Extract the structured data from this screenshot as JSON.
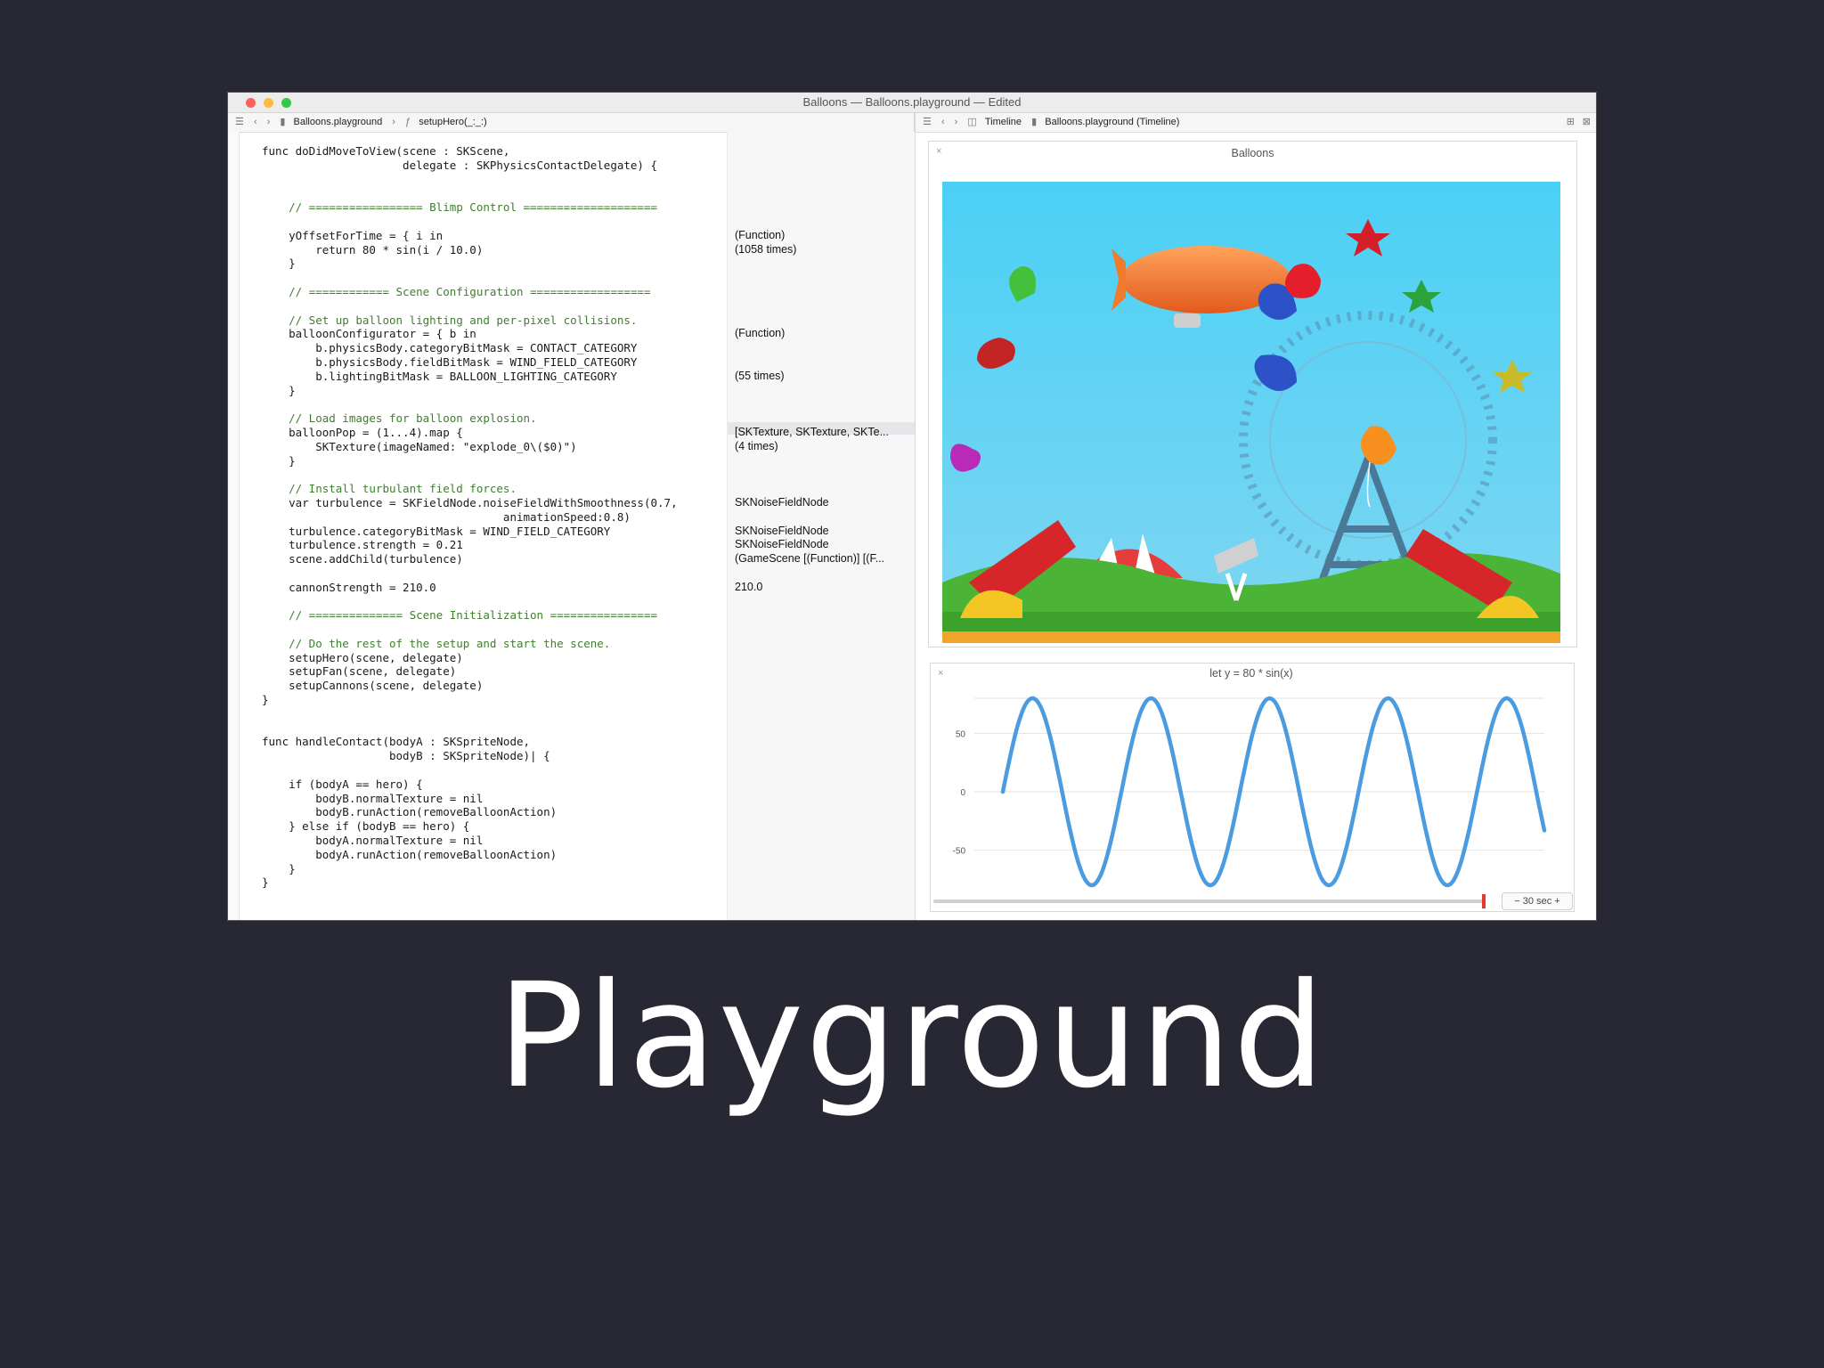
{
  "window": {
    "title": "Balloons — Balloons.playground — Edited",
    "left_jumpbar": {
      "file": "Balloons.playground",
      "symbol": "setupHero(_:_:)"
    },
    "right_jumpbar": {
      "mode": "Timeline",
      "file": "Balloons.playground (Timeline)"
    }
  },
  "code_lines": [
    {
      "t": "func doDidMoveToView(scene : SKScene,",
      "k": ""
    },
    {
      "t": "                     delegate : SKPhysicsContactDelegate) {",
      "k": ""
    },
    {
      "t": "",
      "k": ""
    },
    {
      "t": "",
      "k": ""
    },
    {
      "t": "    // ================= Blimp Control ====================",
      "k": "com"
    },
    {
      "t": "",
      "k": ""
    },
    {
      "t": "    yOffsetForTime = { i in",
      "k": ""
    },
    {
      "t": "        return 80 * sin(i / 10.0)",
      "k": ""
    },
    {
      "t": "    }",
      "k": ""
    },
    {
      "t": "",
      "k": ""
    },
    {
      "t": "    // ============ Scene Configuration ==================",
      "k": "com"
    },
    {
      "t": "",
      "k": ""
    },
    {
      "t": "    // Set up balloon lighting and per-pixel collisions.",
      "k": "com"
    },
    {
      "t": "    balloonConfigurator = { b in",
      "k": ""
    },
    {
      "t": "        b.physicsBody.categoryBitMask = CONTACT_CATEGORY",
      "k": ""
    },
    {
      "t": "        b.physicsBody.fieldBitMask = WIND_FIELD_CATEGORY",
      "k": ""
    },
    {
      "t": "        b.lightingBitMask = BALLOON_LIGHTING_CATEGORY",
      "k": ""
    },
    {
      "t": "    }",
      "k": ""
    },
    {
      "t": "",
      "k": ""
    },
    {
      "t": "    // Load images for balloon explosion.",
      "k": "com"
    },
    {
      "t": "    balloonPop = (1...4).map {",
      "k": ""
    },
    {
      "t": "        SKTexture(imageNamed: \"explode_0\\($0)\")",
      "k": ""
    },
    {
      "t": "    }",
      "k": ""
    },
    {
      "t": "",
      "k": ""
    },
    {
      "t": "    // Install turbulant field forces.",
      "k": "com"
    },
    {
      "t": "    var turbulence = SKFieldNode.noiseFieldWithSmoothness(0.7,",
      "k": ""
    },
    {
      "t": "                                    animationSpeed:0.8)",
      "k": ""
    },
    {
      "t": "    turbulence.categoryBitMask = WIND_FIELD_CATEGORY",
      "k": ""
    },
    {
      "t": "    turbulence.strength = 0.21",
      "k": ""
    },
    {
      "t": "    scene.addChild(turbulence)",
      "k": ""
    },
    {
      "t": "",
      "k": ""
    },
    {
      "t": "    cannonStrength = 210.0",
      "k": ""
    },
    {
      "t": "",
      "k": ""
    },
    {
      "t": "    // ============== Scene Initialization ================",
      "k": "com"
    },
    {
      "t": "",
      "k": ""
    },
    {
      "t": "    // Do the rest of the setup and start the scene.",
      "k": "com"
    },
    {
      "t": "    setupHero(scene, delegate)",
      "k": ""
    },
    {
      "t": "    setupFan(scene, delegate)",
      "k": ""
    },
    {
      "t": "    setupCannons(scene, delegate)",
      "k": ""
    },
    {
      "t": "}",
      "k": ""
    },
    {
      "t": "",
      "k": ""
    },
    {
      "t": "",
      "k": ""
    },
    {
      "t": "func handleContact(bodyA : SKSpriteNode,",
      "k": ""
    },
    {
      "t": "                   bodyB : SKSpriteNode)| {",
      "k": ""
    },
    {
      "t": "",
      "k": ""
    },
    {
      "t": "    if (bodyA == hero) {",
      "k": ""
    },
    {
      "t": "        bodyB.normalTexture = nil",
      "k": ""
    },
    {
      "t": "        bodyB.runAction(removeBalloonAction)",
      "k": ""
    },
    {
      "t": "    } else if (bodyB == hero) {",
      "k": ""
    },
    {
      "t": "        bodyA.normalTexture = nil",
      "k": ""
    },
    {
      "t": "        bodyA.runAction(removeBalloonAction)",
      "k": ""
    },
    {
      "t": "    }",
      "k": ""
    },
    {
      "t": "}",
      "k": ""
    }
  ],
  "results": [
    {
      "line": 6,
      "text": "(Function)"
    },
    {
      "line": 7,
      "text": "(1058 times)"
    },
    {
      "line": 13,
      "text": "(Function)"
    },
    {
      "line": 16,
      "text": "(55 times)"
    },
    {
      "line": 20,
      "text": "[SKTexture, SKTexture, SKTe..."
    },
    {
      "line": 21,
      "text": "(4 times)"
    },
    {
      "line": 25,
      "text": "SKNoiseFieldNode"
    },
    {
      "line": 27,
      "text": "SKNoiseFieldNode"
    },
    {
      "line": 28,
      "text": "SKNoiseFieldNode"
    },
    {
      "line": 29,
      "text": "(GameScene [(Function)] [(F..."
    },
    {
      "line": 31,
      "text": "210.0"
    }
  ],
  "scene_panel": {
    "title": "Balloons",
    "close": "×"
  },
  "chart_panel": {
    "close": "×"
  },
  "chart_data": {
    "type": "line",
    "title": "let y = 80 * sin(x)",
    "xlabel": "",
    "ylabel": "",
    "ylim": [
      -80,
      80
    ],
    "yticks": [
      50,
      0,
      -50
    ],
    "series": [
      {
        "formula": "80*sin(i/10)",
        "samples": 287,
        "start_index": 0
      }
    ],
    "grid": true
  },
  "timeline": {
    "duration_label": "30 sec"
  },
  "slide_title": "Playground",
  "colors": {
    "background": "#282834",
    "sky": "#36c0ef",
    "line": "#4a9be0"
  }
}
